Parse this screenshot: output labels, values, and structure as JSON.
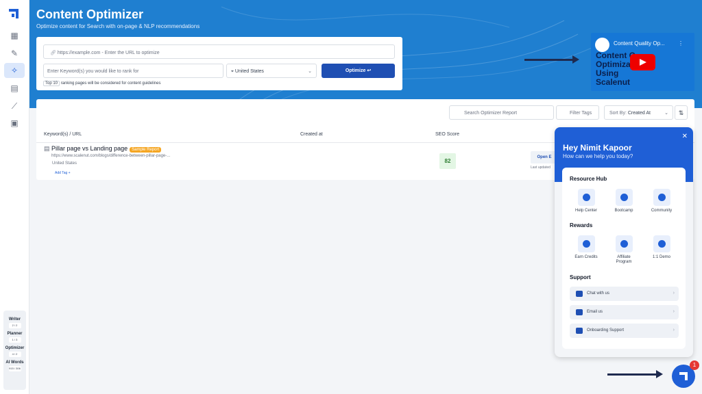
{
  "app": {
    "title": "Content Optimizer",
    "subtitle": "Optimize content for Search with on-page & NLP recommendations"
  },
  "sidebar": {
    "nav_icons": [
      "dashboard-icon",
      "document-edit-icon",
      "magic-wand-icon",
      "clipboard-icon",
      "chart-line-icon",
      "chip-icon"
    ],
    "active_index": 2,
    "usage": [
      {
        "label": "Writer",
        "value": "2 / 2"
      },
      {
        "label": "Planner",
        "value": "1 / 3"
      },
      {
        "label": "Optimizer",
        "value": "4 / 2"
      },
      {
        "label": "AI Words",
        "value": "915 / 306"
      }
    ]
  },
  "form": {
    "url_placeholder": "https://example.com - Enter the URL to optimize",
    "keyword_placeholder": "Enter Keyword(s) you would like to rank for",
    "country": "United States",
    "optimize_label": "Optimize ↩",
    "top_value": "Top 10",
    "top_suffix": "ranking pages will be considered for content guidelines"
  },
  "video": {
    "title": "Content Quality Op...",
    "big_text": "Content Q... Optimizati... Using Scalenut"
  },
  "toolbar": {
    "search_placeholder": "Search Optimizer Report",
    "filter_label": "Filter Tags",
    "sort_label": "Sort By:",
    "sort_value": "Created At"
  },
  "table": {
    "headers": [
      "Keyword(s) / URL",
      "Created at",
      "SEO Score"
    ],
    "rows": [
      {
        "title": "Pillar page vs Landing page",
        "badge": "Sample Report",
        "url": "https://www.scalenut.com/blogs/difference-between-pillar-page-...",
        "location": "United States",
        "add_tag": "Add Tag +",
        "seo_score": "82",
        "open_label": "Open E",
        "last_updated": "Last updated"
      }
    ]
  },
  "help_panel": {
    "greeting": "Hey Nimit Kapoor",
    "sub": "How can we help you today?",
    "resource_hub": {
      "title": "Resource Hub",
      "items": [
        "Help Center",
        "Bootcamp",
        "Community"
      ]
    },
    "rewards": {
      "title": "Rewards",
      "items": [
        "Earn Credits",
        "Affiliate Program",
        "1:1 Demo"
      ]
    },
    "support": {
      "title": "Support",
      "items": [
        "Chat with us",
        "Email us",
        "Onboarding Support"
      ]
    }
  },
  "fab": {
    "badge": "1"
  },
  "colors": {
    "brand": "#1f5fd6",
    "hero": "#1f7fd0",
    "score_bg": "#e3f6e4",
    "badge": "#f5a623"
  }
}
